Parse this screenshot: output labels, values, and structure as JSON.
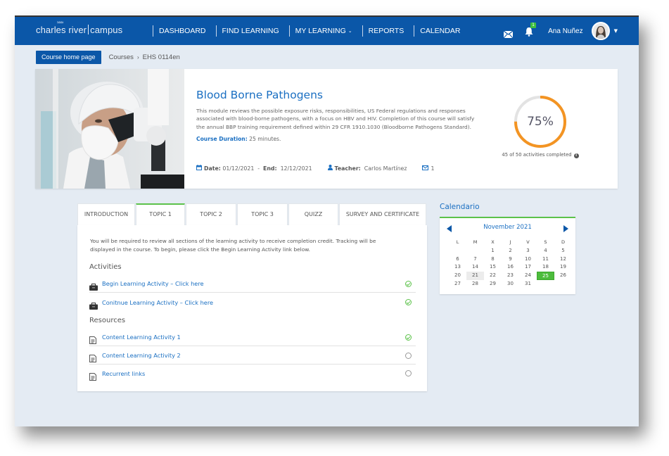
{
  "nav": {
    "logo_left": "charles river",
    "logo_right": "campus",
    "items": [
      {
        "label": "DASHBOARD"
      },
      {
        "label": "FIND LEARNING"
      },
      {
        "label": "MY LEARNING",
        "has_dropdown": true
      },
      {
        "label": "REPORTS"
      },
      {
        "label": "CALENDAR"
      }
    ],
    "mail_icon": "envelope-icon",
    "bell_icon": "bell-icon",
    "notification_count": "1",
    "user_name": "Ana Nuñez",
    "avatar_icon": "user-avatar",
    "brand_color": "#0b57a8"
  },
  "breadcrumb": {
    "home_button": "Course home page",
    "items": [
      "Courses",
      "EHS 0114en"
    ],
    "separator": "›"
  },
  "course": {
    "title": "Blood Borne Pathogens",
    "description": "This module reviews the possible exposure risks, responsibilities, US Federal regulations and responses associated with blood-borne pathogens, with a focus on HBV and HIV. Completion of this course will satisfy the annual BBP training requirement defined within 29 CFR 1910.1030 (Bloodborne Pathogens Standard).",
    "duration_label": "Course Duration:",
    "duration_value": "25 minutes.",
    "date_label": "Date:",
    "date_value": "01/12/2021",
    "end_label": "End:",
    "end_value": "12/12/2021",
    "teacher_label": "Teacher:",
    "teacher_value": "Carlos Martínez",
    "messages_count": "1",
    "image_alt": "Scientist in hairnet and mask looking into a microscope"
  },
  "progress": {
    "percent_label": "75%",
    "percent": 75,
    "summary": "45 of 50 activities completed",
    "ring_color": "#f39423",
    "track_color": "#e0e0e0"
  },
  "tabs": [
    {
      "label": "INTRODUCTION",
      "active": false
    },
    {
      "label": "TOPIC 1",
      "active": true
    },
    {
      "label": "TOPIC 2",
      "active": false
    },
    {
      "label": "TOPIC 3",
      "active": false
    },
    {
      "label": "QUIZZ",
      "active": false
    },
    {
      "label": "SURVEY AND CERTIFICATE",
      "active": false
    }
  ],
  "panel": {
    "intro": "You will be required to review all sections of the learning activity to receive completion credit.  Tracking will be displayed in the course. To begin, please click the Begin Learning Activity link below.",
    "activities_heading": "Activities",
    "activities": [
      {
        "label": "Begin Learning Activity – Click here",
        "icon": "briefcase-icon",
        "completed": true
      },
      {
        "label": "Conitnue Learning Activity – Click here",
        "icon": "briefcase-icon",
        "completed": true
      }
    ],
    "resources_heading": "Resources",
    "resources": [
      {
        "label": "Content Learning Activity 1",
        "icon": "document-icon",
        "completed": true
      },
      {
        "label": "Content Learning Activity 2",
        "icon": "document-icon",
        "completed": false
      },
      {
        "label": "Recurrent links",
        "icon": "document-icon",
        "completed": false
      }
    ]
  },
  "calendar": {
    "title": "Calendario",
    "month_label": "November 2021",
    "weekdays": [
      "L",
      "M",
      "X",
      "J",
      "V",
      "S",
      "D"
    ],
    "leading_blanks": 2,
    "days_in_month": 31,
    "today": 21,
    "selected": 25,
    "accent_color": "#4cbc3c"
  }
}
